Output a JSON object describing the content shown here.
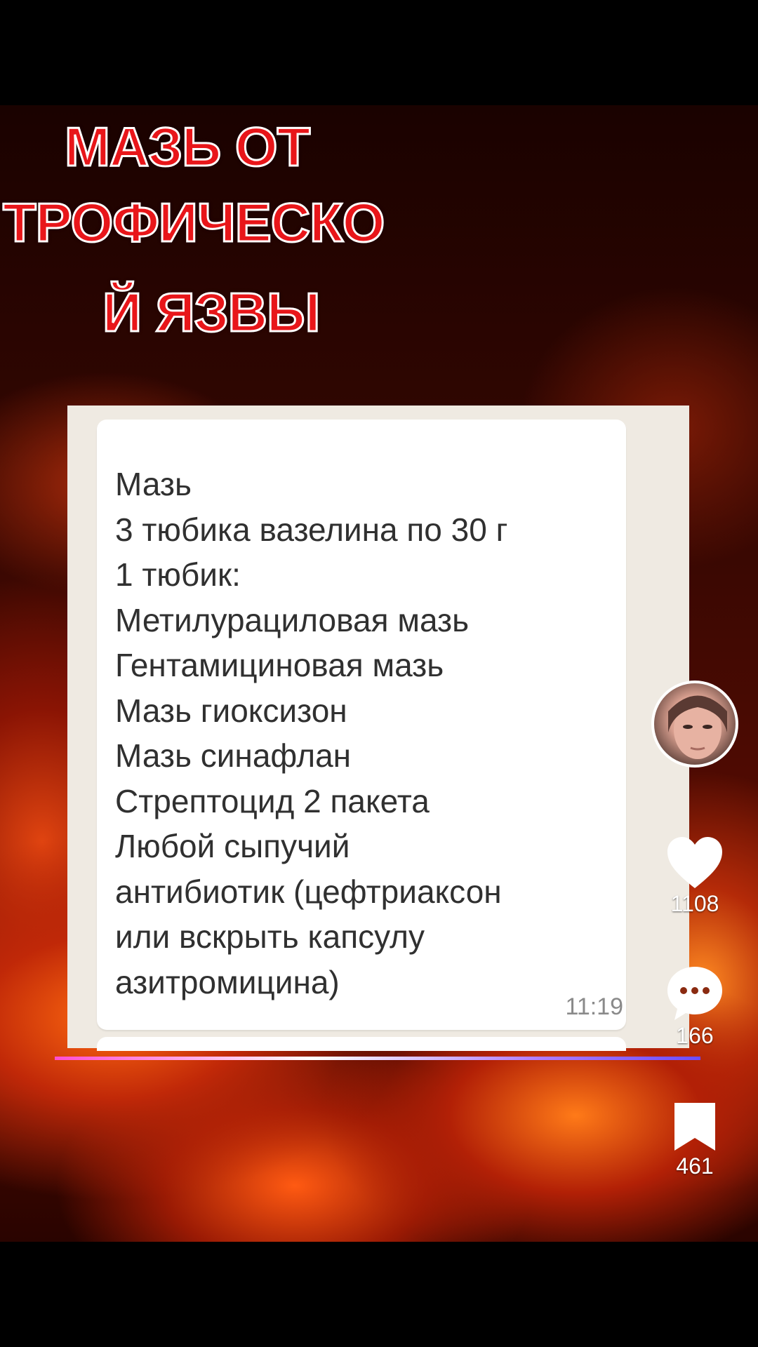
{
  "title": {
    "line1": "МАЗЬ ОТ",
    "line2": "ТРОФИЧЕСКО",
    "line3": "Й ЯЗВЫ"
  },
  "message": {
    "text": "Мазь\n3 тюбика вазелина по 30 г\n1 тюбик:\nМетилурациловая мазь\nГентамициновая мазь\nМазь гиоксизон\nМазь синафлан\nСтрептоцид 2 пакета\nЛюбой сыпучий\nантибиотик (цефтриаксон\nили вскрыть капсулу\nазитромицина)",
    "time": "11:19"
  },
  "actions": {
    "likes": "1108",
    "comments": "166",
    "bookmarks": "461"
  },
  "icons": {
    "like": "heart-icon",
    "comment": "comment-bubble-icon",
    "bookmark": "bookmark-icon"
  },
  "colors": {
    "title_fill": "#e8161a",
    "title_stroke": "#ffffff",
    "chat_background": "#efeae2"
  },
  "progress": {
    "played_fraction": 0.92
  }
}
